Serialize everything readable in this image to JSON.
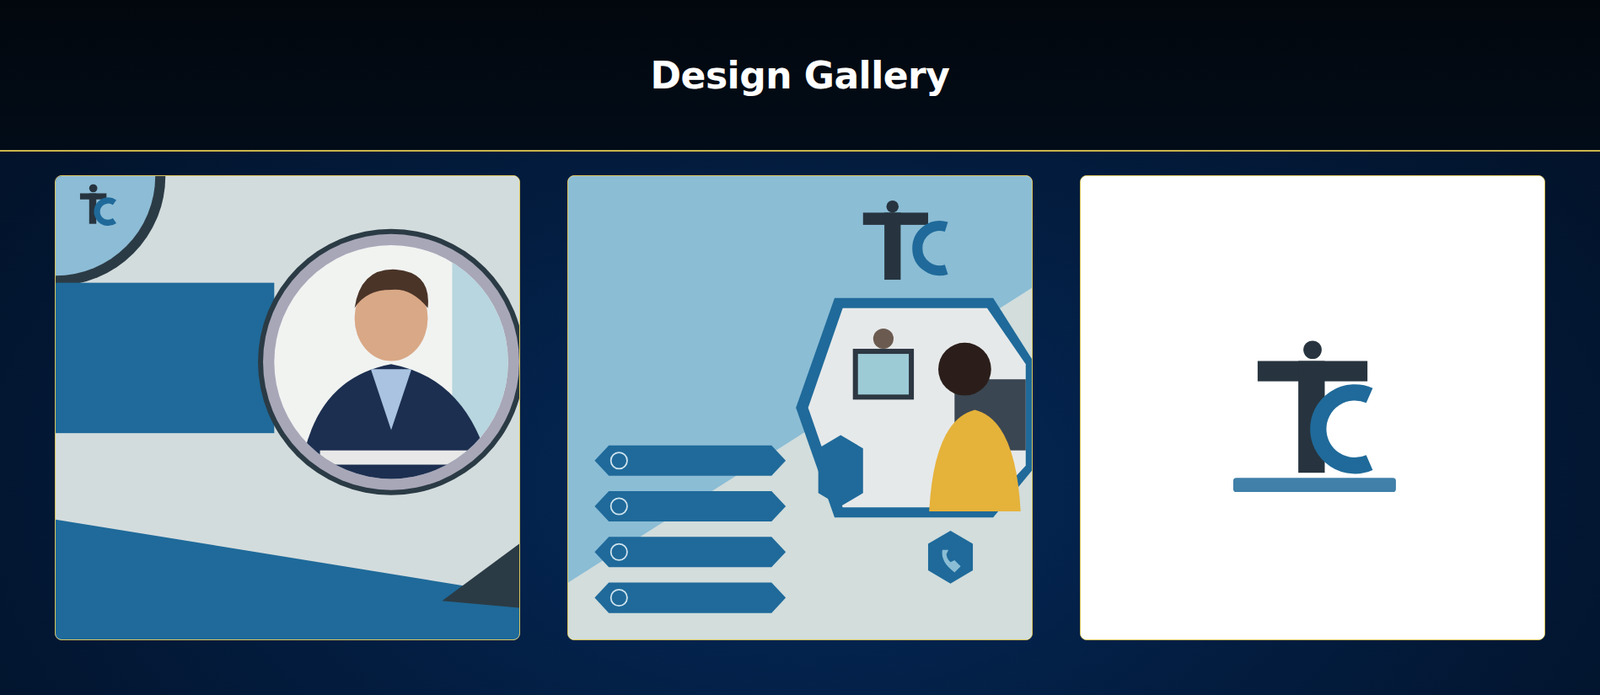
{
  "header": {
    "title": "Design Gallery"
  },
  "gallery": [
    {
      "kind": "expert"
    },
    {
      "kind": "course"
    },
    {
      "kind": "logo"
    }
  ]
}
